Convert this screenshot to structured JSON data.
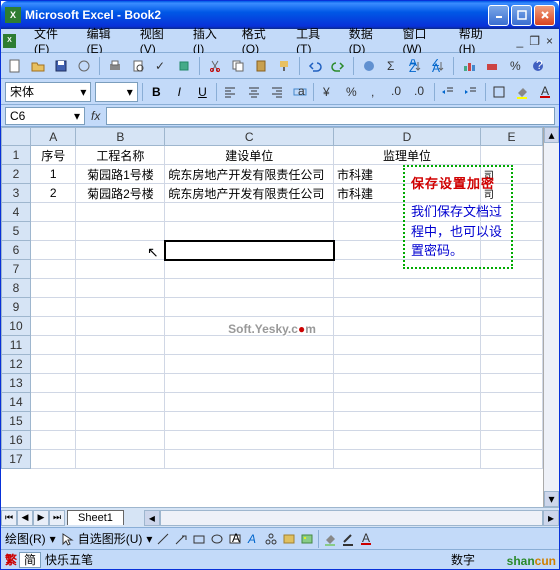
{
  "window": {
    "title": "Microsoft Excel - Book2"
  },
  "menu": {
    "file": "文件(F)",
    "edit": "编辑(E)",
    "view": "视图(V)",
    "insert": "插入(I)",
    "format": "格式(O)",
    "tools": "工具(T)",
    "data": "数据(D)",
    "window": "窗口(W)",
    "help": "帮助(H)"
  },
  "format_bar": {
    "font_name": "宋体",
    "bold": "B",
    "italic": "I",
    "underline": "U"
  },
  "cellref": {
    "name": "C6",
    "fx": "fx"
  },
  "headers": {
    "A": "A",
    "B": "B",
    "C": "C",
    "D": "D",
    "E": "E"
  },
  "rows": [
    "1",
    "2",
    "3",
    "4",
    "5",
    "6",
    "7",
    "8",
    "9",
    "10",
    "11",
    "12",
    "13",
    "14",
    "15",
    "16",
    "17"
  ],
  "table": {
    "header": {
      "seq": "序号",
      "proj": "工程名称",
      "unit": "建设单位",
      "super": "监理单位"
    },
    "data": [
      {
        "seq": "1",
        "proj": "菊园路1号楼",
        "unit": "皖东房地产开发有限责任公司",
        "super": "市科建",
        "e": "司"
      },
      {
        "seq": "2",
        "proj": "菊园路2号楼",
        "unit": "皖东房地产开发有限责任公司",
        "super": "市科建",
        "e": "司"
      }
    ]
  },
  "sheet_tab": "Sheet1",
  "drawbar": {
    "draw": "绘图(R)",
    "autoshape": "自选图形(U)"
  },
  "status": {
    "ime_label": "简",
    "ime_name": "快乐五笔",
    "numeric": "数字"
  },
  "note": {
    "title": "保存设置加密",
    "body": "我们保存文档过程中，也可以设置密码。"
  },
  "watermark": {
    "p1": "Soft.Yesky.c",
    "p2": "m"
  },
  "logo": {
    "p1": "shan",
    "p2": "cun"
  }
}
